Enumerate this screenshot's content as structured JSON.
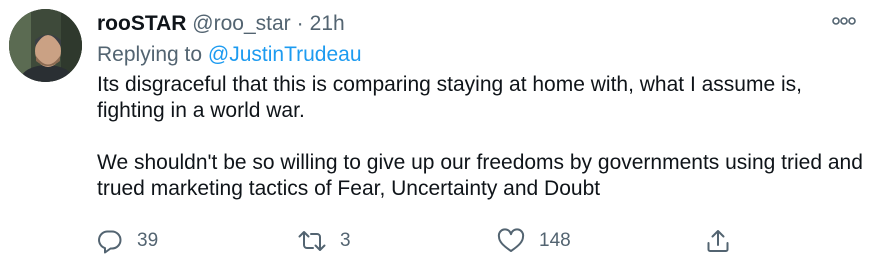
{
  "tweet": {
    "author": {
      "name": "rooSTAR",
      "handle": "@roo_star",
      "separator": "·",
      "time": "21h"
    },
    "reply_prefix": "Replying to ",
    "reply_to": "@JustinTrudeau",
    "paragraphs": [
      "Its disgraceful that this is comparing staying at home with, what I assume is, fighting in a world war.",
      "We shouldn't be so willing to give up our freedoms by governments using tried and trued marketing tactics of Fear, Uncertainty and Doubt"
    ],
    "actions": {
      "reply_count": "39",
      "retweet_count": "3",
      "like_count": "148"
    }
  },
  "icons": {
    "more": "more-icon",
    "reply": "reply-icon",
    "retweet": "retweet-icon",
    "like": "heart-icon",
    "share": "share-icon"
  },
  "colors": {
    "text": "#0f1419",
    "secondary": "#536471",
    "link": "#1d9bf0"
  }
}
